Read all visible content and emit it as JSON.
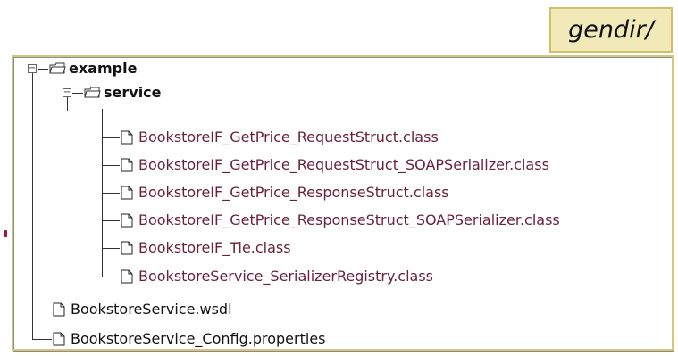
{
  "header": {
    "title": "gendir/"
  },
  "tree": {
    "folders": [
      {
        "label": "example"
      },
      {
        "label": "service"
      }
    ],
    "classes": [
      "BookstoreIF_GetPrice_RequestStruct.class",
      "BookstoreIF_GetPrice_RequestStruct_SOAPSerializer.class",
      "BookstoreIF_GetPrice_ResponseStruct.class",
      "BookstoreIF_GetPrice_ResponseStruct_SOAPSerializer.class",
      "BookstoreIF_Tie.class",
      "BookstoreService_SerializerRegistry.class"
    ],
    "files": [
      "BookstoreService.wsdl",
      "BookstoreService_Config.properties"
    ]
  },
  "colors": {
    "accent_box": "#f1e9b8",
    "class_text": "#6a1f3a"
  },
  "icons": {
    "folder": "folder-open-icon",
    "file": "document-icon",
    "expanded": "minus-box-icon"
  }
}
